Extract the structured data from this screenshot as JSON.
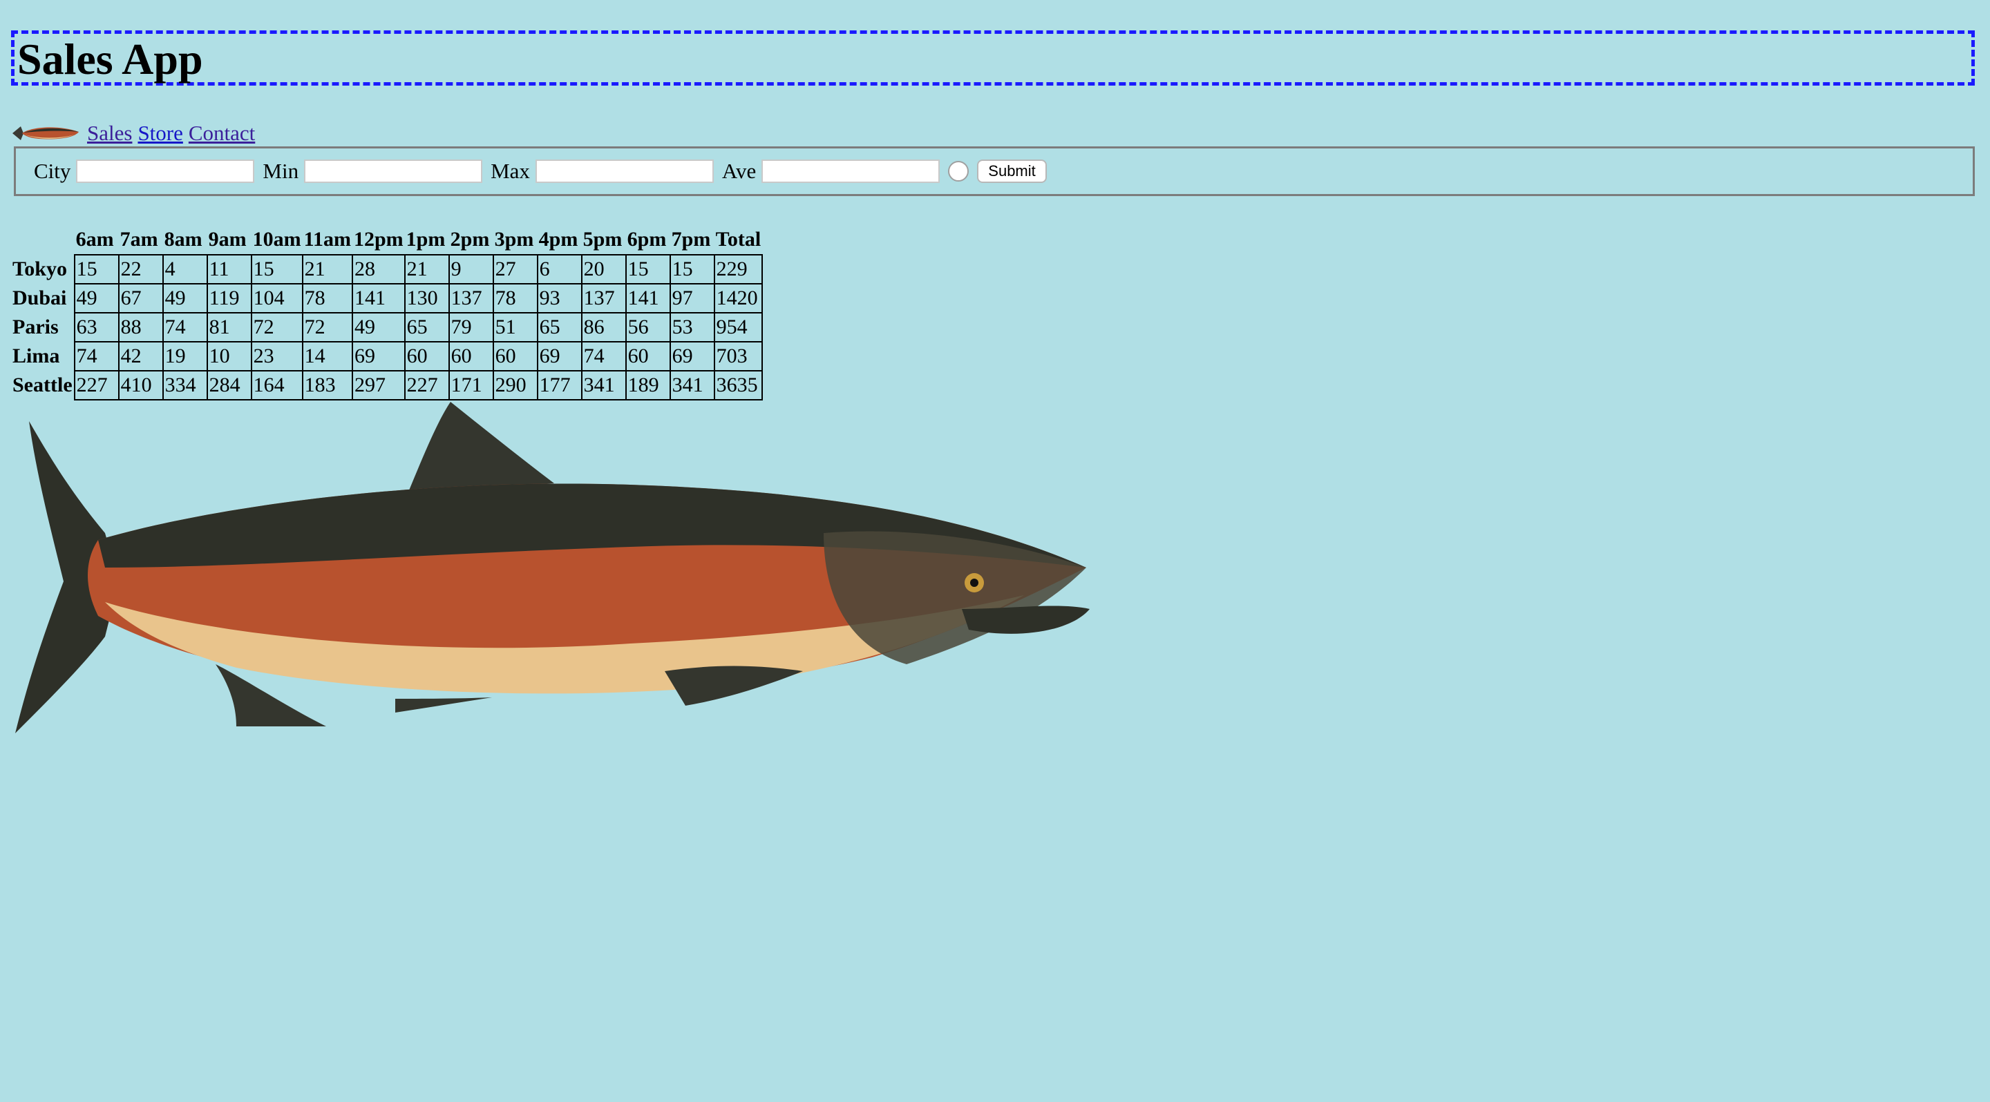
{
  "header": {
    "title": "Sales App"
  },
  "nav": {
    "logo_icon": "salmon-logo-icon",
    "links": [
      {
        "label": "Sales"
      },
      {
        "label": "Store"
      },
      {
        "label": "Contact"
      }
    ]
  },
  "form": {
    "fields": [
      {
        "label": "City",
        "value": "",
        "placeholder": ""
      },
      {
        "label": "Min",
        "value": "",
        "placeholder": ""
      },
      {
        "label": "Max",
        "value": "",
        "placeholder": ""
      },
      {
        "label": "Ave",
        "value": "",
        "placeholder": ""
      }
    ],
    "submit_label": "Submit"
  },
  "table": {
    "headers": [
      "6am",
      "7am",
      "8am",
      "9am",
      "10am",
      "11am",
      "12pm",
      "1pm",
      "2pm",
      "3pm",
      "4pm",
      "5pm",
      "6pm",
      "7pm",
      "Total"
    ],
    "rows": [
      {
        "city": "Tokyo",
        "values": [
          "15",
          "22",
          "4",
          "11",
          "15",
          "21",
          "28",
          "21",
          "9",
          "27",
          "6",
          "20",
          "15",
          "15",
          "229"
        ]
      },
      {
        "city": "Dubai",
        "values": [
          "49",
          "67",
          "49",
          "119",
          "104",
          "78",
          "141",
          "130",
          "137",
          "78",
          "93",
          "137",
          "141",
          "97",
          "1420"
        ]
      },
      {
        "city": "Paris",
        "values": [
          "63",
          "88",
          "74",
          "81",
          "72",
          "72",
          "49",
          "65",
          "79",
          "51",
          "65",
          "86",
          "56",
          "53",
          "954"
        ]
      },
      {
        "city": "Lima",
        "values": [
          "74",
          "42",
          "19",
          "10",
          "23",
          "14",
          "69",
          "60",
          "60",
          "60",
          "69",
          "74",
          "60",
          "69",
          "703"
        ]
      },
      {
        "city": "Seattle",
        "values": [
          "227",
          "410",
          "334",
          "284",
          "164",
          "183",
          "297",
          "227",
          "171",
          "290",
          "177",
          "341",
          "189",
          "341",
          "3635"
        ]
      }
    ]
  },
  "image": {
    "icon": "salmon-illustration",
    "colors": {
      "back": "#2e3028",
      "belly": "#e9c48c",
      "stripe": "#b8522e"
    }
  }
}
